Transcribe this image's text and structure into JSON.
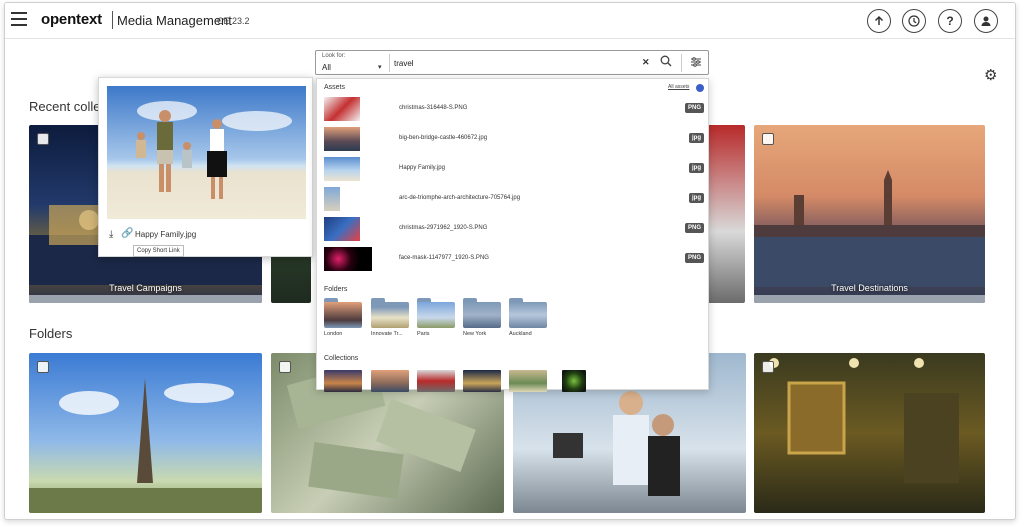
{
  "header": {
    "brand": "opentext",
    "product": "Media Management",
    "version": "CE 23.2",
    "buttons": [
      "upload-icon",
      "history-icon",
      "help-icon",
      "user-icon"
    ]
  },
  "sections": {
    "recent_collections": "Recent colle",
    "folders": "Folders"
  },
  "tiles": {
    "travel_campaigns": "Travel Campaigns",
    "travel_destinations": "Travel Destinations"
  },
  "preview": {
    "file_name": "Happy Family.jpg",
    "tooltip": "Copy Short Link"
  },
  "search": {
    "look_for_label": "Look for:",
    "look_for_value": "All",
    "query": "travel"
  },
  "dropdown": {
    "assets_heading": "Assets",
    "all_assets_link": "All assets",
    "assets": [
      {
        "name": "christmas-316448-S.PNG",
        "type": "PNG"
      },
      {
        "name": "big-ben-bridge-castle-460672.jpg",
        "type": "jpg"
      },
      {
        "name": "Happy Family.jpg",
        "type": "jpg"
      },
      {
        "name": "arc-de-triomphe-arch-architecture-705764.jpg",
        "type": "jpg"
      },
      {
        "name": "christmas-2971962_1920-S.PNG",
        "type": "PNG"
      },
      {
        "name": "face-mask-1147977_1920-S.PNG",
        "type": "PNG"
      }
    ],
    "folders_heading": "Folders",
    "folders": [
      "London",
      "Innovate Tr...",
      "Paris",
      "New York",
      "Auckland"
    ],
    "collections_heading": "Collections"
  },
  "colors": {
    "accent": "#3b5fc9",
    "badge": "#555555",
    "folder": "#7e99b8"
  }
}
